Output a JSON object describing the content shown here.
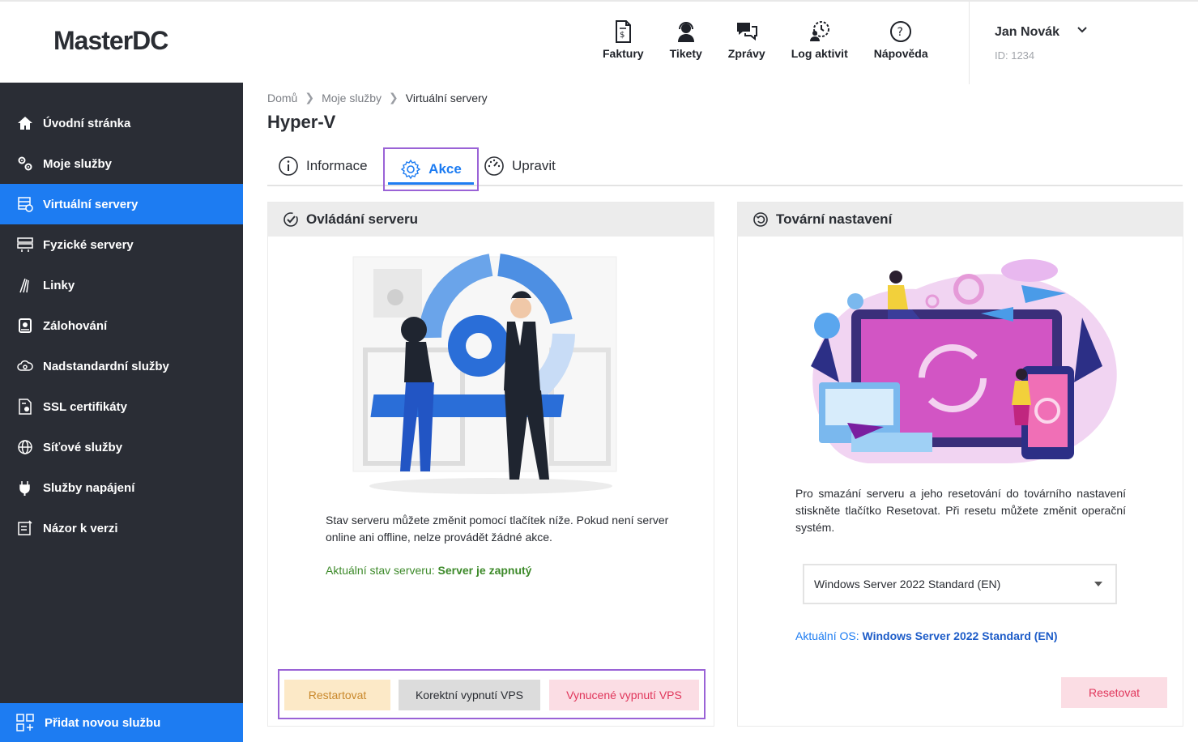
{
  "header": {
    "logo": "MasterDC",
    "nav": [
      {
        "label": "Faktury",
        "icon": "invoice-icon"
      },
      {
        "label": "Tikety",
        "icon": "support-agent-icon"
      },
      {
        "label": "Zprávy",
        "icon": "chat-icon"
      },
      {
        "label": "Log aktivit",
        "icon": "activity-log-icon"
      },
      {
        "label": "Nápověda",
        "icon": "help-icon"
      }
    ],
    "user": {
      "name": "Jan Novák",
      "id": "ID: 1234"
    }
  },
  "sidebar": {
    "items": [
      {
        "label": "Úvodní stránka",
        "icon": "home-icon",
        "active": false
      },
      {
        "label": "Moje služby",
        "icon": "services-icon",
        "active": false
      },
      {
        "label": "Virtuální servery",
        "icon": "virtual-server-icon",
        "active": true
      },
      {
        "label": "Fyzické servery",
        "icon": "physical-server-icon",
        "active": false
      },
      {
        "label": "Linky",
        "icon": "fiber-icon",
        "active": false
      },
      {
        "label": "Zálohování",
        "icon": "backup-icon",
        "active": false
      },
      {
        "label": "Nadstandardní služby",
        "icon": "cloud-gear-icon",
        "active": false
      },
      {
        "label": "SSL certifikáty",
        "icon": "certificate-icon",
        "active": false
      },
      {
        "label": "Síťové služby",
        "icon": "globe-icon",
        "active": false
      },
      {
        "label": "Služby napájení",
        "icon": "plug-icon",
        "active": false
      },
      {
        "label": "Názor k verzi",
        "icon": "feedback-icon",
        "active": false
      }
    ],
    "add_service": "Přidat novou službu"
  },
  "breadcrumb": [
    "Domů",
    "Moje služby",
    "Virtuální servery"
  ],
  "page_title": "Hyper-V",
  "tabs": [
    {
      "label": "Informace",
      "icon": "info-icon"
    },
    {
      "label": "Akce",
      "icon": "gear-icon",
      "active": true
    },
    {
      "label": "Upravit",
      "icon": "dashboard-icon"
    }
  ],
  "server_control": {
    "title": "Ovládání serveru",
    "description": "Stav serveru můžete změnit pomocí tlačítek níže. Pokud není server online ani offline, nelze provádět žádné akce.",
    "state_label": "Aktuální stav serveru:",
    "state_value": "Server je zapnutý",
    "buttons": {
      "restart": "Restartovat",
      "graceful": "Korektní vypnutí VPS",
      "force": "Vynucené vypnutí VPS"
    }
  },
  "factory_reset": {
    "title": "Tovární nastavení",
    "description": "Pro smazání serveru a jeho resetování do továrního nastavení stiskněte tlačítko Resetovat. Při resetu můžete změnit operační systém.",
    "os_select": "Windows Server 2022 Standard (EN)",
    "current_os_label": "Aktuální OS:",
    "current_os_value": "Windows Server 2022 Standard (EN)",
    "reset_button": "Resetovat"
  },
  "colors": {
    "sidebar_bg": "#2a2d35",
    "accent": "#1d7cf2",
    "highlight_border": "#9a63d6",
    "status_green": "#3d8a2a",
    "danger": "#e0365b",
    "warning": "#c9882b"
  }
}
